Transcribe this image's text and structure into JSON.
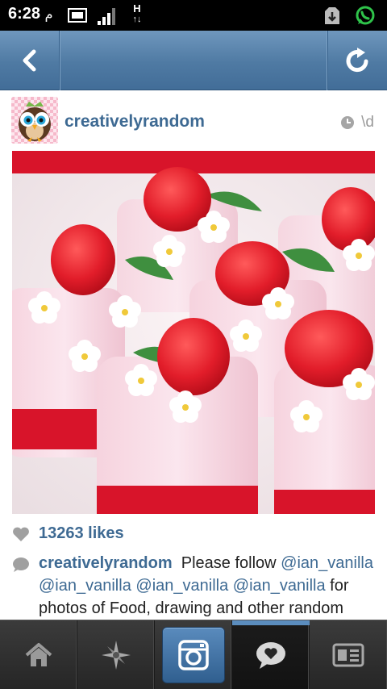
{
  "status_bar": {
    "time": "6:28",
    "time_suffix": "م",
    "network_label": "H",
    "icons": [
      "screen-icon",
      "signal-icon",
      "network-icon",
      "download-icon",
      "whatsapp-icon"
    ]
  },
  "action_bar": {
    "back_icon": "back-chevron-icon",
    "refresh_icon": "refresh-icon",
    "accent": "#4f7aa3"
  },
  "post": {
    "username": "creativelyrandom",
    "time_ago": "\\d",
    "avatar": "owl-avatar",
    "photo": "strawberry-cakes-photo",
    "likes": "13263 likes",
    "caption": {
      "user": "creativelyrandom",
      "intro": "Please follow",
      "mentions": [
        "@ian_vanilla",
        "@ian_vanilla",
        "@ian_vanilla",
        "@ian_vanilla"
      ],
      "rest": "for photos of Food, drawing and other random"
    }
  },
  "tab_bar": {
    "tabs": [
      {
        "icon": "home-icon",
        "active": false
      },
      {
        "icon": "explore-star-icon",
        "active": false
      },
      {
        "icon": "camera-icon",
        "active": false
      },
      {
        "icon": "news-bubble-icon",
        "active": true
      },
      {
        "icon": "profile-card-icon",
        "active": false
      }
    ]
  }
}
